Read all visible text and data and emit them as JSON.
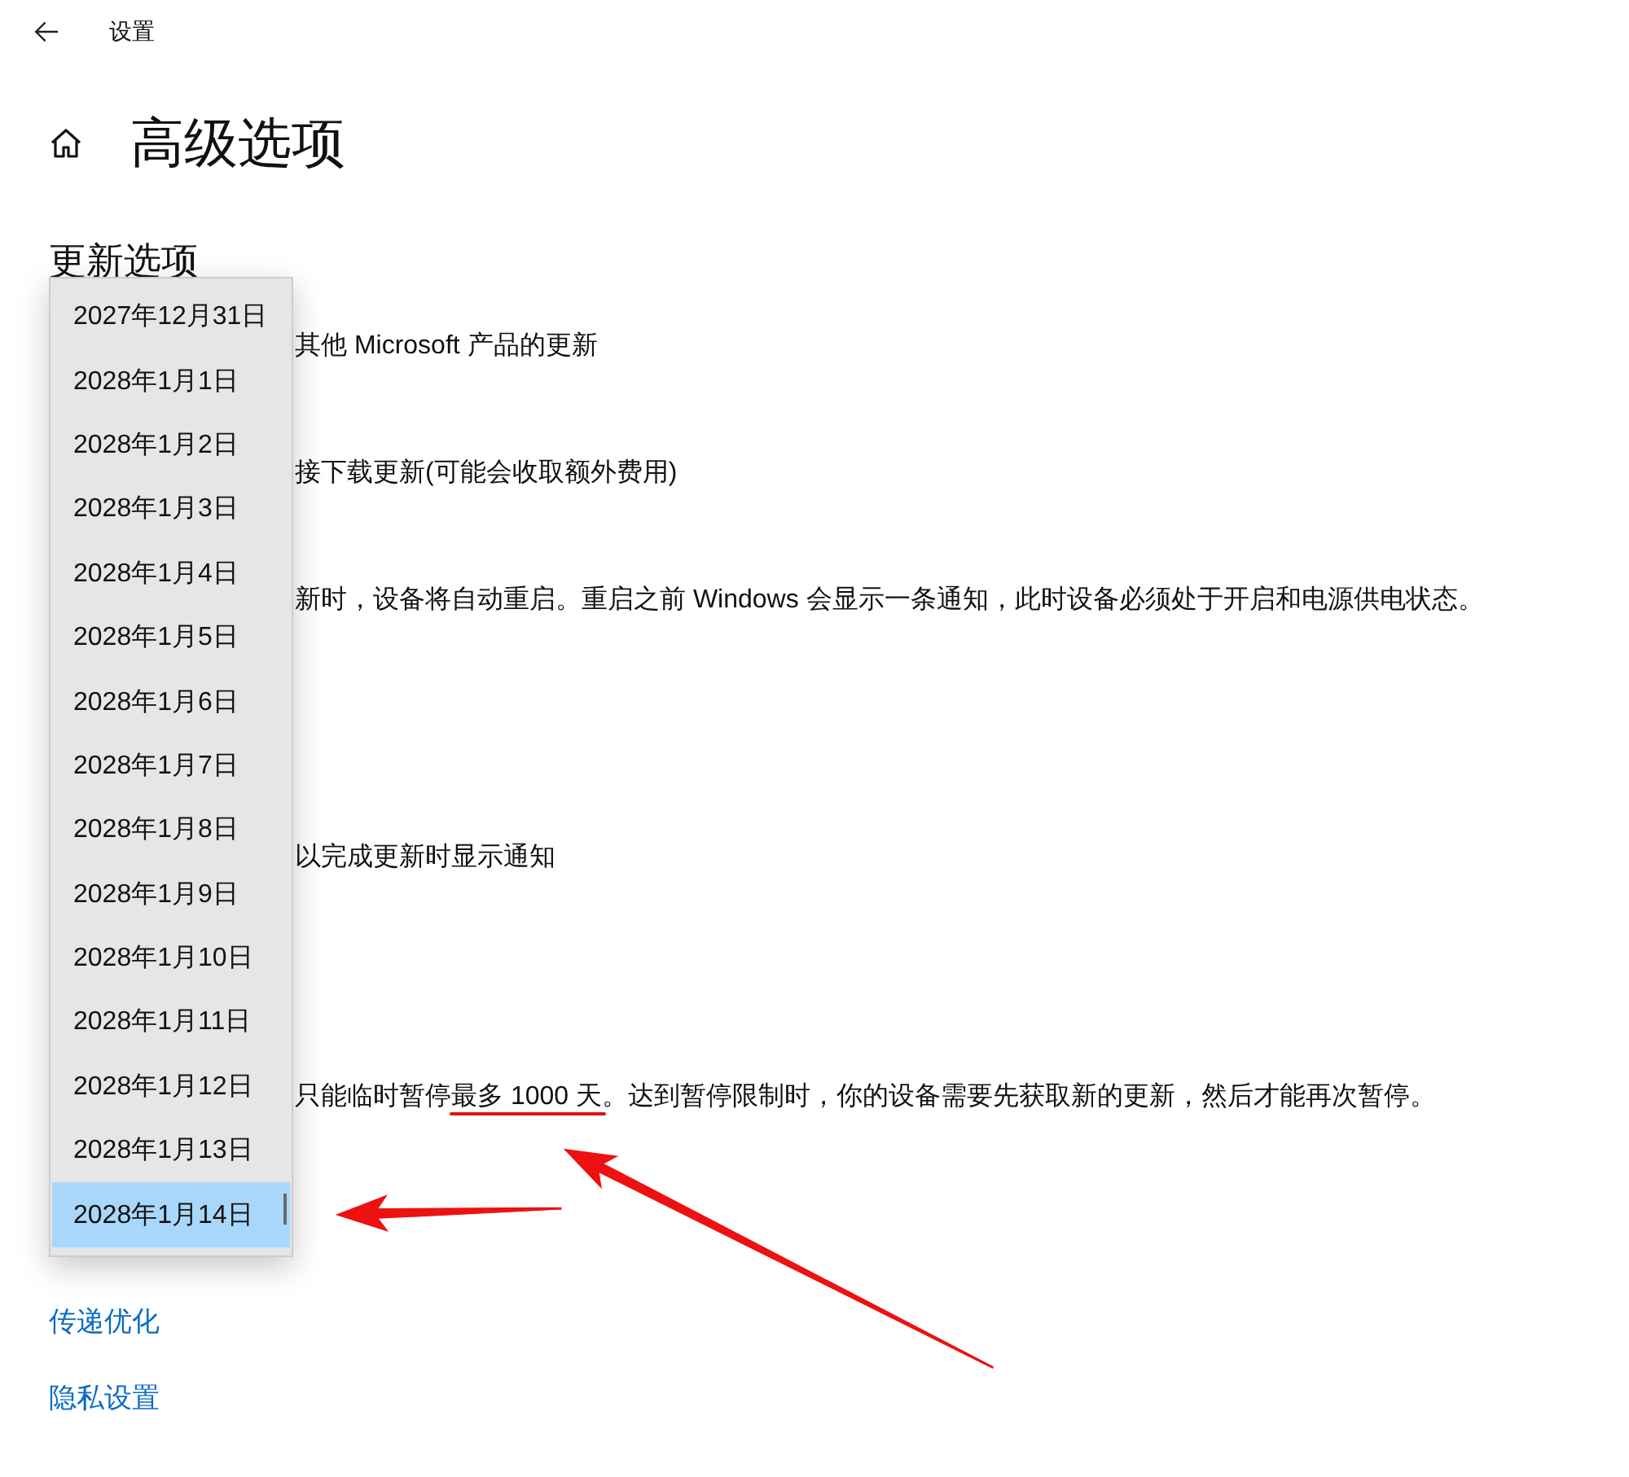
{
  "header": {
    "title": "设置"
  },
  "page": {
    "title": "高级选项"
  },
  "update_options": {
    "heading": "更新选项",
    "lines": [
      {
        "parts": [
          {
            "text": "其他 Microsoft 产品的更新",
            "underlined": false
          }
        ]
      },
      {
        "parts": [
          {
            "text": "接下载更新(可能会收取额外费用)",
            "underlined": false
          }
        ]
      },
      {
        "parts": [
          {
            "text": "新时，设备将自动重启。重启之前 Windows 会显示一条通知，此时设备必须处于开启和电源供电状态。",
            "underlined": false
          }
        ]
      },
      {
        "parts": [
          {
            "text": "以完成更新时显示通知",
            "underlined": false
          }
        ]
      },
      {
        "parts": [
          {
            "text": "只能临时暂停",
            "underlined": false
          },
          {
            "text": "最多 1000 天",
            "underlined": true
          },
          {
            "text": "。达到暂停限制时，你的设备需要先获取新的更新，然后才能再次暂停。",
            "underlined": false
          }
        ]
      }
    ]
  },
  "date_dropdown": {
    "items": [
      {
        "label": "2027年12月31日",
        "selected": false
      },
      {
        "label": "2028年1月1日",
        "selected": false
      },
      {
        "label": "2028年1月2日",
        "selected": false
      },
      {
        "label": "2028年1月3日",
        "selected": false
      },
      {
        "label": "2028年1月4日",
        "selected": false
      },
      {
        "label": "2028年1月5日",
        "selected": false
      },
      {
        "label": "2028年1月6日",
        "selected": false
      },
      {
        "label": "2028年1月7日",
        "selected": false
      },
      {
        "label": "2028年1月8日",
        "selected": false
      },
      {
        "label": "2028年1月9日",
        "selected": false
      },
      {
        "label": "2028年1月10日",
        "selected": false
      },
      {
        "label": "2028年1月11日",
        "selected": false
      },
      {
        "label": "2028年1月12日",
        "selected": false
      },
      {
        "label": "2028年1月13日",
        "selected": false
      },
      {
        "label": "2028年1月14日",
        "selected": true
      }
    ]
  },
  "links": [
    {
      "label": "传递优化"
    },
    {
      "label": "隐私设置"
    }
  ]
}
